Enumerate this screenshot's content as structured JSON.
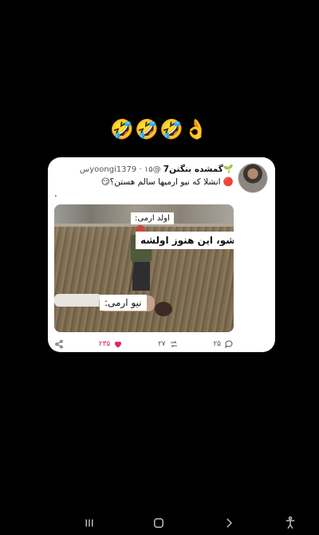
{
  "emoji_row": "🤣🤣🤣👌",
  "tweet": {
    "display_name": "🌱گمشده بنگتن7",
    "handle": "@yoongi1379",
    "time": "۱۵س",
    "separator": "·",
    "text": "🔴 انشلا که نیو ارمیها سالم هستن؟😏",
    "stray_mark": ".",
    "image": {
      "label_old": "اولد ارمی:",
      "caption": "پاشو، این هنوز اولشه",
      "label_new": "نیو ارمی:"
    },
    "actions": {
      "replies": "۲۵",
      "retweets": "۲۷",
      "likes": "۲۳۵",
      "like_color": "#e0245e"
    }
  },
  "icons": [
    "share-icon",
    "heart-icon",
    "retweet-icon",
    "reply-icon",
    "recents-icon",
    "home-icon",
    "back-icon",
    "accessibility-icon"
  ]
}
